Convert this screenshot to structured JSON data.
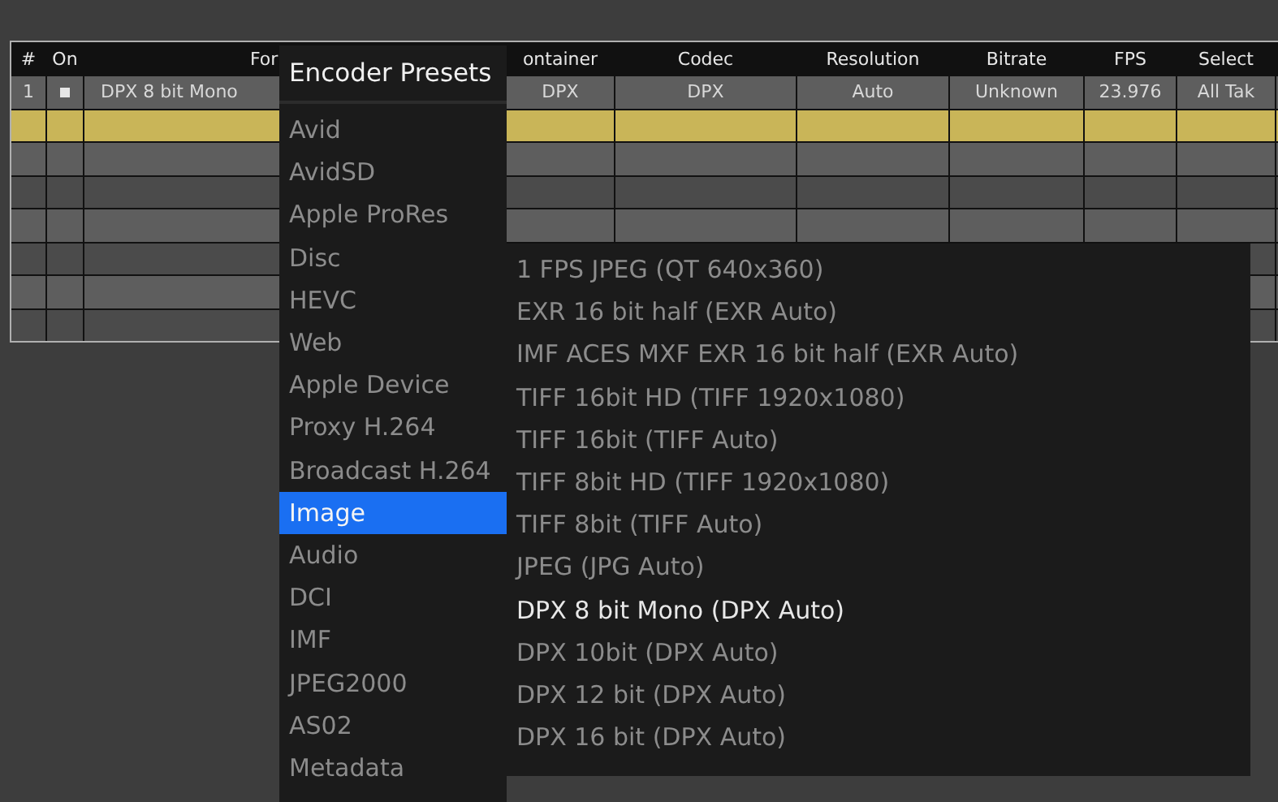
{
  "table": {
    "columns": [
      "#",
      "On",
      "For",
      "ontainer",
      "Codec",
      "Resolution",
      "Bitrate",
      "FPS",
      "Select"
    ],
    "rows": [
      {
        "selected": false,
        "on": true,
        "cells": [
          "1",
          "",
          "DPX 8 bit Mono",
          "DPX",
          "DPX",
          "Auto",
          "Unknown",
          "23.976",
          "All Tak"
        ]
      },
      {
        "selected": true,
        "on": false,
        "cells": []
      },
      {
        "selected": false,
        "on": false,
        "cells": []
      },
      {
        "selected": false,
        "on": false,
        "cells": []
      },
      {
        "selected": false,
        "on": false,
        "cells": []
      },
      {
        "selected": false,
        "on": false,
        "cells": []
      },
      {
        "selected": false,
        "on": false,
        "cells": []
      },
      {
        "selected": false,
        "on": false,
        "cells": []
      }
    ]
  },
  "menu": {
    "title": "Encoder Presets",
    "items": [
      {
        "label": "Avid",
        "selected": false
      },
      {
        "label": "AvidSD",
        "selected": false
      },
      {
        "label": "Apple ProRes",
        "selected": false
      },
      {
        "label": "Disc",
        "selected": false
      },
      {
        "label": "HEVC",
        "selected": false
      },
      {
        "label": "Web",
        "selected": false
      },
      {
        "label": "Apple Device",
        "selected": false
      },
      {
        "label": "Proxy H.264",
        "selected": false
      },
      {
        "label": "Broadcast H.264",
        "selected": false
      },
      {
        "label": "Image",
        "selected": true
      },
      {
        "label": "Audio",
        "selected": false
      },
      {
        "label": "DCI",
        "selected": false
      },
      {
        "label": "IMF",
        "selected": false
      },
      {
        "label": "JPEG2000",
        "selected": false
      },
      {
        "label": "AS02",
        "selected": false
      },
      {
        "label": "Metadata",
        "selected": false
      }
    ]
  },
  "submenu": {
    "items": [
      {
        "label": "1 FPS JPEG  (QT 640x360)",
        "current": false
      },
      {
        "label": "EXR 16 bit half  (EXR Auto)",
        "current": false
      },
      {
        "label": "IMF ACES MXF EXR 16 bit half  (EXR Auto)",
        "current": false
      },
      {
        "label": "TIFF 16bit HD  (TIFF 1920x1080)",
        "current": false
      },
      {
        "label": "TIFF 16bit  (TIFF Auto)",
        "current": false
      },
      {
        "label": "TIFF 8bit HD  (TIFF 1920x1080)",
        "current": false
      },
      {
        "label": "TIFF 8bit  (TIFF Auto)",
        "current": false
      },
      {
        "label": "JPEG  (JPG Auto)",
        "current": false
      },
      {
        "label": "DPX 8 bit Mono  (DPX Auto)",
        "current": true
      },
      {
        "label": "DPX 10bit  (DPX Auto)",
        "current": false
      },
      {
        "label": "DPX 12 bit  (DPX Auto)",
        "current": false
      },
      {
        "label": "DPX 16 bit  (DPX Auto)",
        "current": false
      }
    ]
  }
}
